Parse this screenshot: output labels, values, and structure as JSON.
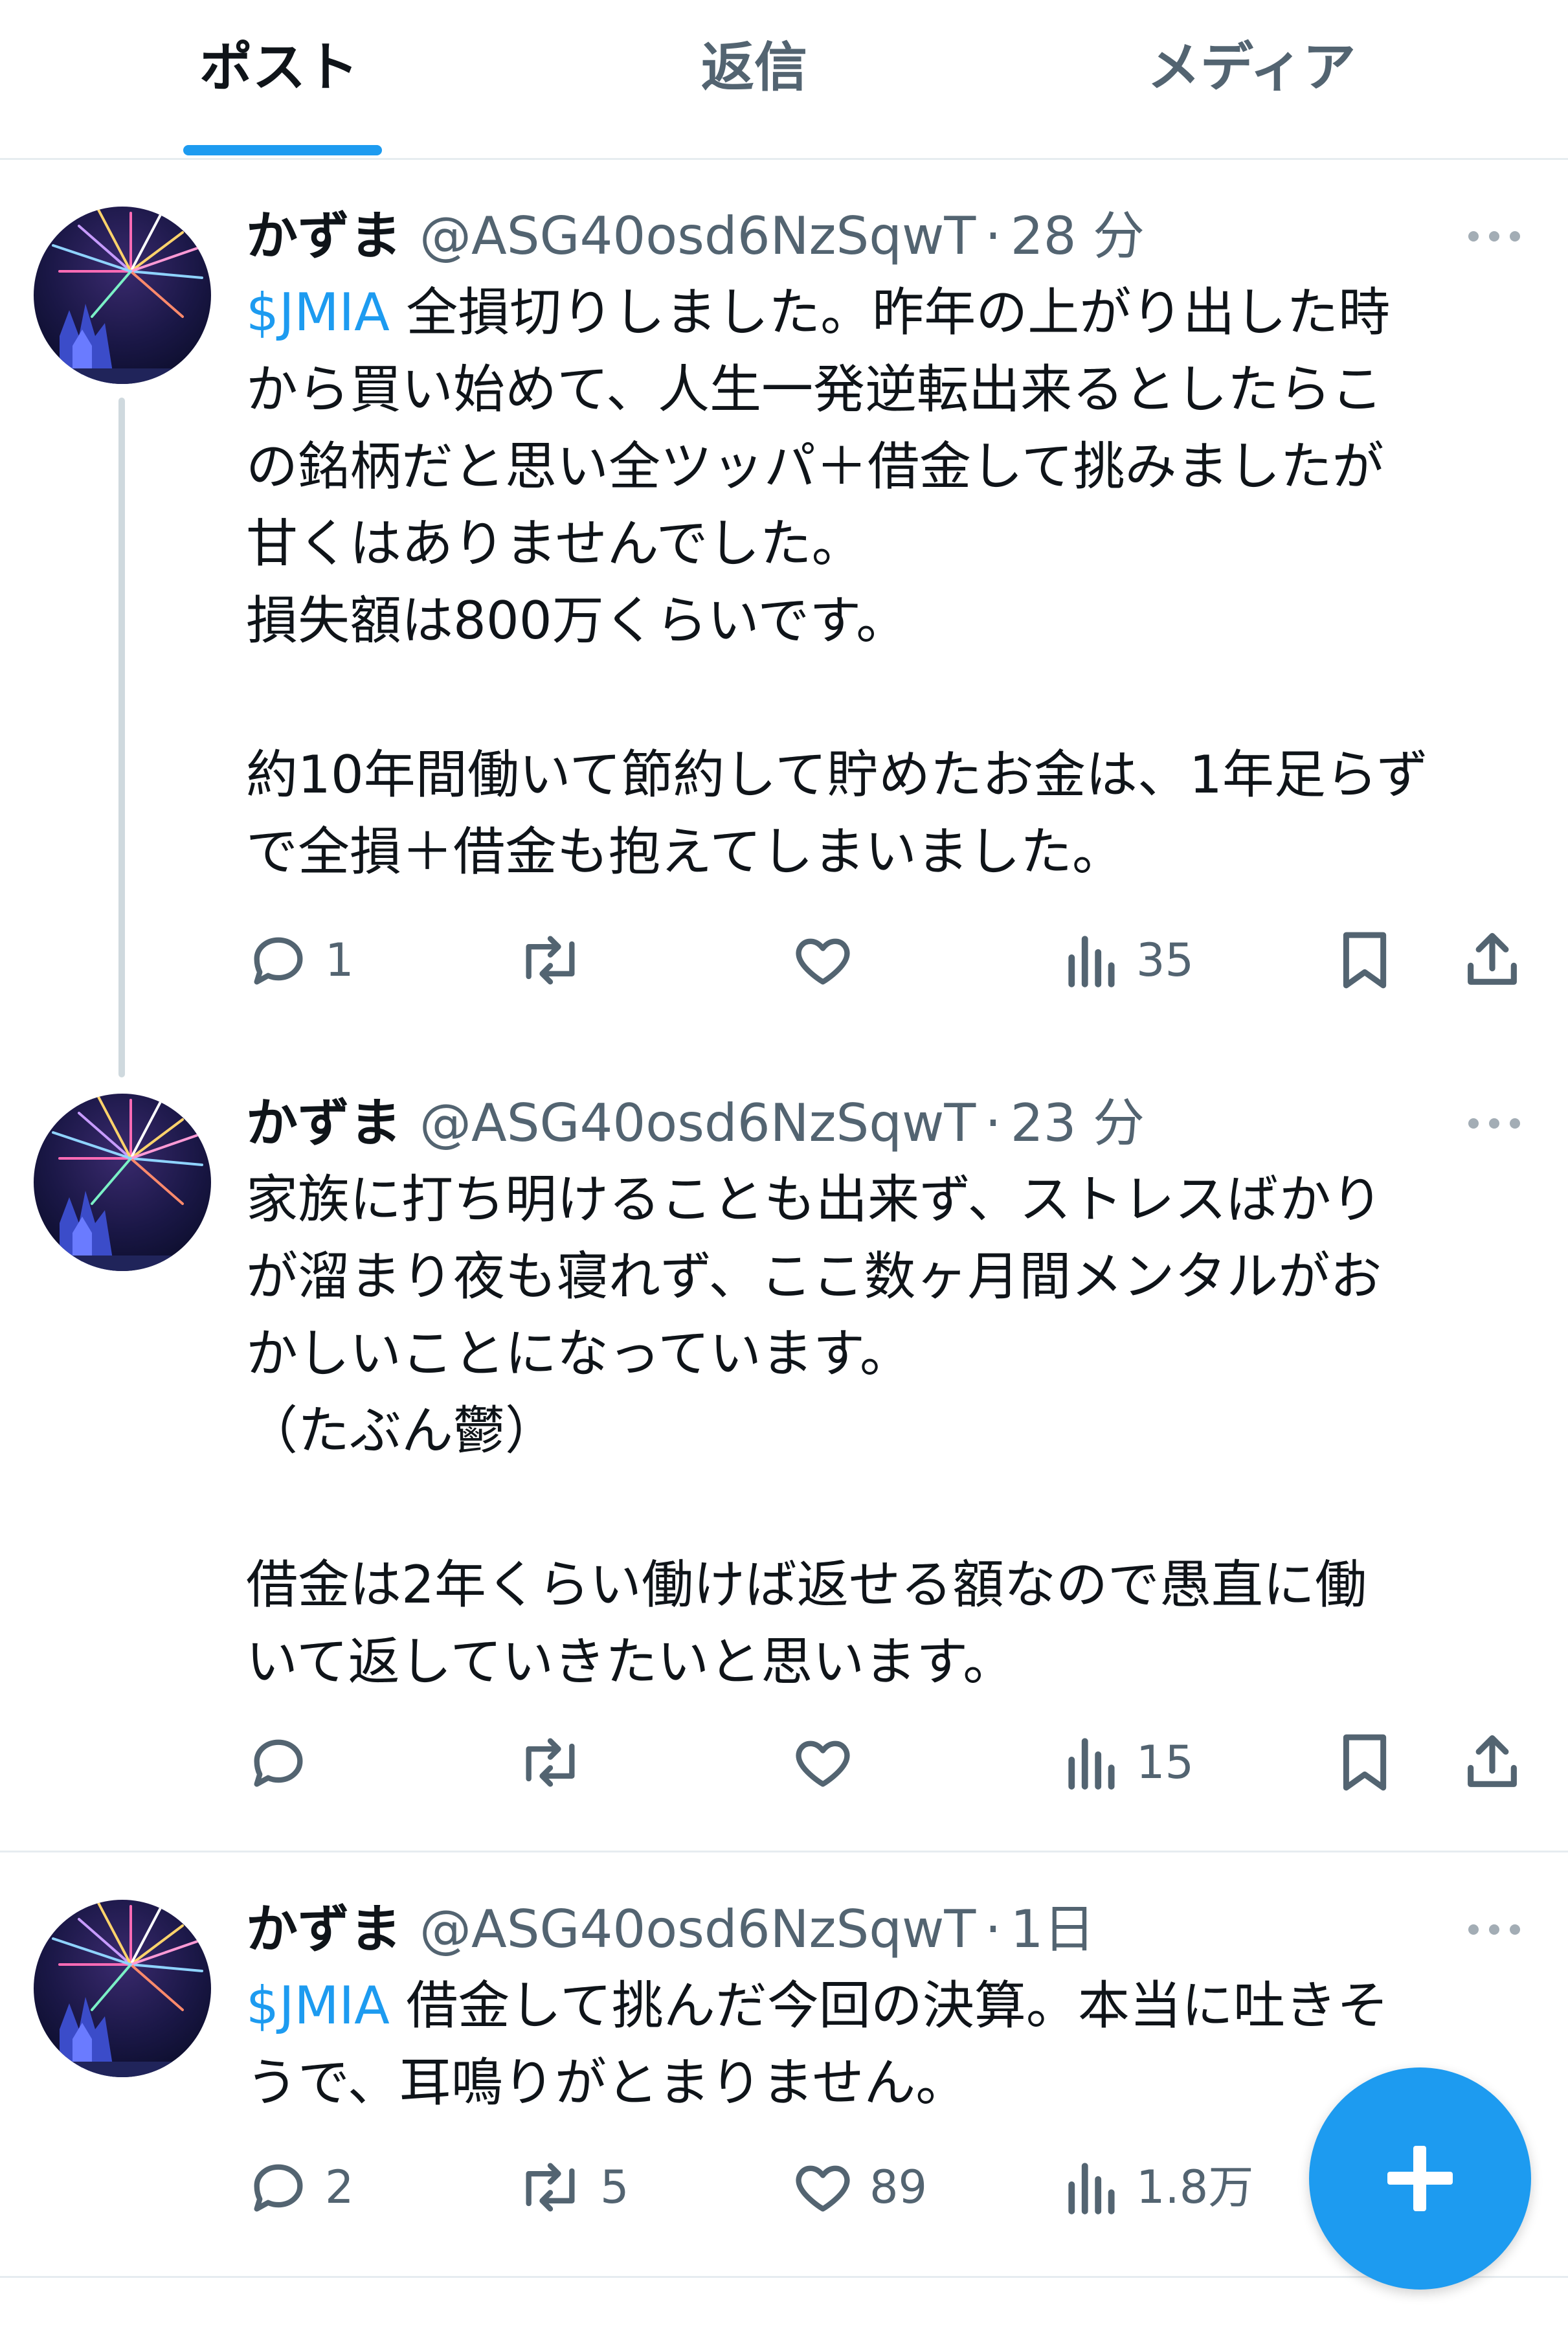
{
  "tabs": [
    {
      "label": "ポスト",
      "active": true
    },
    {
      "label": "返信",
      "active": false
    },
    {
      "label": "メディア",
      "active": false
    }
  ],
  "posts": [
    {
      "name": "かずま",
      "handle": "@ASG40osd6NzSqwT",
      "time": "28 分",
      "lines": [
        {
          "cashtag": "$JMIA",
          "text": " 全損切りしました。昨年の上がり出した時"
        },
        {
          "cashtag": "",
          "text": "から買い始めて、人生一発逆転出来るとしたらこ"
        },
        {
          "cashtag": "",
          "text": "の銘柄だと思い全ツッパ＋借金して挑みましたが"
        },
        {
          "cashtag": "",
          "text": "甘くはありませんでした。"
        },
        {
          "cashtag": "",
          "text": "損失額は800万くらいです。"
        },
        {
          "cashtag": "",
          "text": ""
        },
        {
          "cashtag": "",
          "text": "約10年間働いて節約して貯めたお金は、1年足らず"
        },
        {
          "cashtag": "",
          "text": "で全損＋借金も抱えてしまいました。"
        }
      ],
      "replies": "1",
      "reposts": "",
      "likes": "",
      "views": "35"
    },
    {
      "name": "かずま",
      "handle": "@ASG40osd6NzSqwT",
      "time": "23 分",
      "lines": [
        {
          "cashtag": "",
          "text": "家族に打ち明けることも出来ず、ストレスばかり"
        },
        {
          "cashtag": "",
          "text": "が溜まり夜も寝れず、ここ数ヶ月間メンタルがお"
        },
        {
          "cashtag": "",
          "text": "かしいことになっています。"
        },
        {
          "cashtag": "",
          "text": "（たぶん鬱）"
        },
        {
          "cashtag": "",
          "text": ""
        },
        {
          "cashtag": "",
          "text": "借金は2年くらい働けば返せる額なので愚直に働"
        },
        {
          "cashtag": "",
          "text": "いて返していきたいと思います。"
        }
      ],
      "replies": "",
      "reposts": "",
      "likes": "",
      "views": "15"
    },
    {
      "name": "かずま",
      "handle": "@ASG40osd6NzSqwT",
      "time": "1日",
      "lines": [
        {
          "cashtag": "$JMIA",
          "text": " 借金して挑んだ今回の決算。本当に吐きそ"
        },
        {
          "cashtag": "",
          "text": "うで、耳鳴りがとまりません。"
        }
      ],
      "replies": "2",
      "reposts": "5",
      "likes": "89",
      "views": "1.8万"
    }
  ],
  "icons": {
    "reply": "reply-icon",
    "repost": "repost-icon",
    "like": "heart-icon",
    "views": "views-chart-icon",
    "bookmark": "bookmark-icon",
    "share": "share-icon",
    "more": "more-dots-icon",
    "compose": "plus-icon"
  },
  "colors": {
    "accent": "#1d9bf0",
    "text": "#0f1419",
    "secondary": "#536471",
    "divider": "#e6ecf0"
  }
}
